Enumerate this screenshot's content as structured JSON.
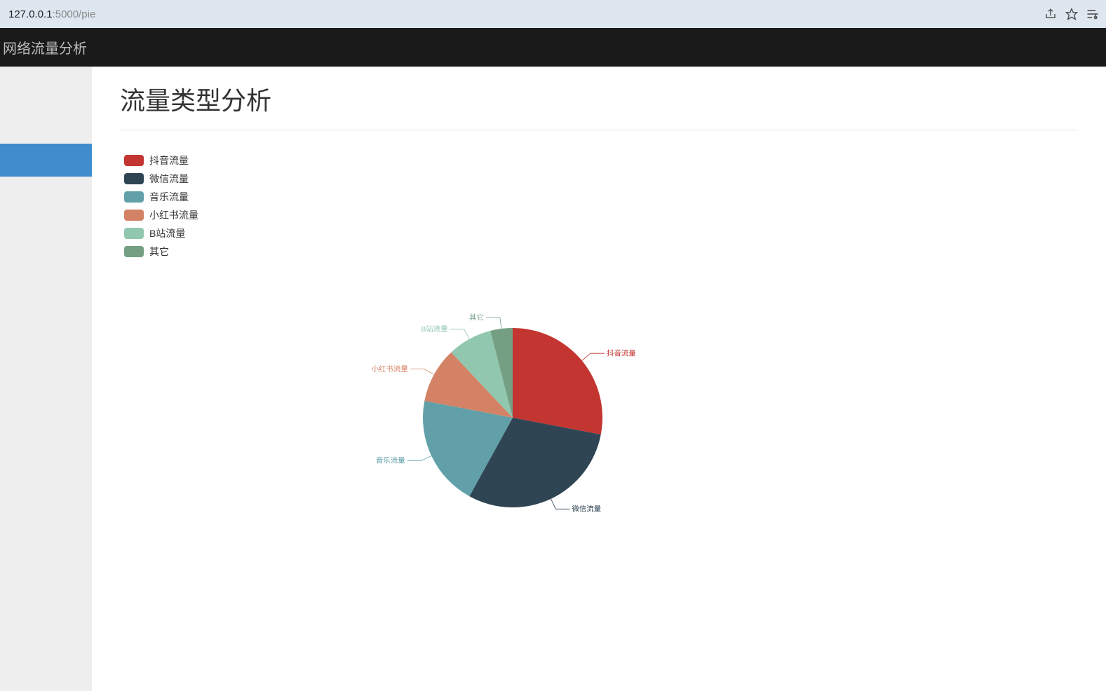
{
  "browser": {
    "url_prefix": "127.0.0.1",
    "url_suffix": ":5000/pie"
  },
  "app": {
    "title": "网络流量分析"
  },
  "page": {
    "title": "流量类型分析"
  },
  "chart_data": {
    "type": "pie",
    "series": [
      {
        "name": "抖音流量",
        "value": 28,
        "color": "#c23531"
      },
      {
        "name": "微信流量",
        "value": 30,
        "color": "#2f4554"
      },
      {
        "name": "音乐流量",
        "value": 20,
        "color": "#61a0a8"
      },
      {
        "name": "小红书流量",
        "value": 10,
        "color": "#d48265"
      },
      {
        "name": "B站流量",
        "value": 8,
        "color": "#91c7ae"
      },
      {
        "name": "其它",
        "value": 4,
        "color": "#749f83"
      }
    ]
  }
}
